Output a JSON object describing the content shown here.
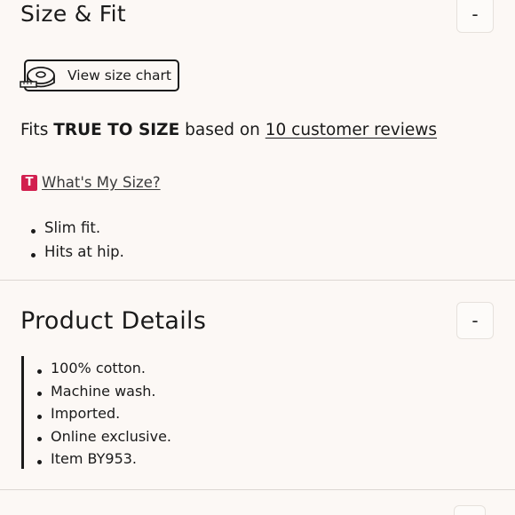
{
  "size_fit": {
    "title": "Size & Fit",
    "collapse_label": "-",
    "size_chart_button": {
      "label": "View size chart",
      "icon": "measuring-tape-icon"
    },
    "fit": {
      "prefix": "Fits ",
      "emphasis": "TRUE TO SIZE",
      "middle": " based on ",
      "reviews_link": "10 customer reviews"
    },
    "whats_my_size": {
      "badge": "T",
      "badge_color": "#d21f4f",
      "link": "What's My Size?"
    },
    "bullets": [
      "Slim fit.",
      "Hits at hip."
    ]
  },
  "product_details": {
    "title": "Product Details",
    "collapse_label": "-",
    "bullets": [
      "100% cotton.",
      "Machine wash.",
      "Imported.",
      "Online exclusive.",
      "Item BY953."
    ]
  }
}
